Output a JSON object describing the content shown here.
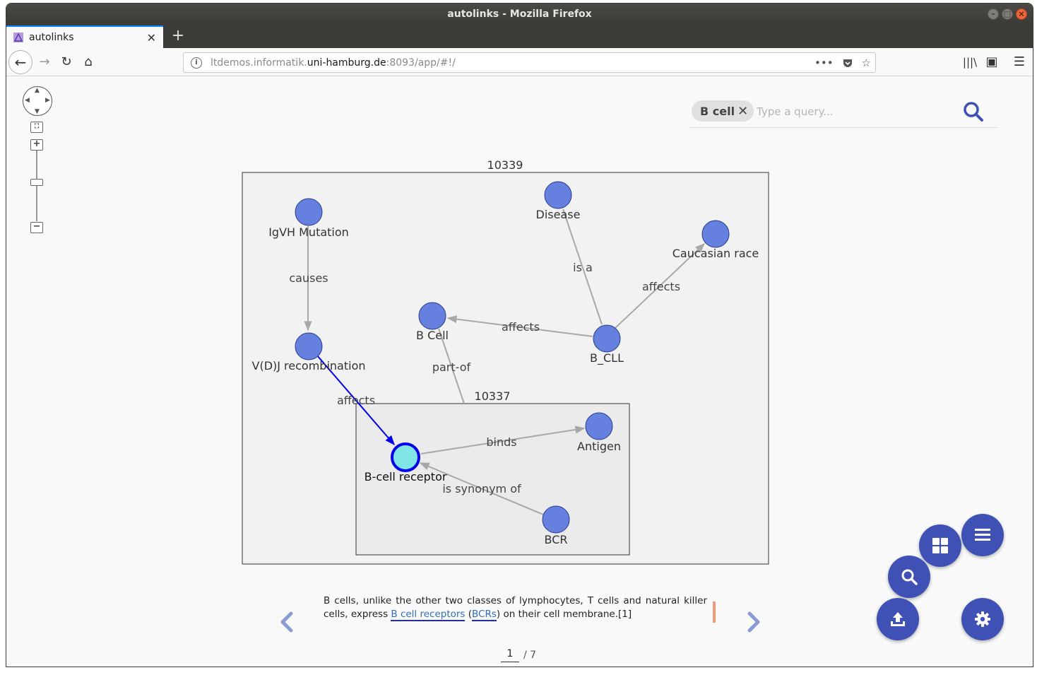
{
  "window": {
    "title": "autolinks - Mozilla Firefox"
  },
  "tab": {
    "title": "autolinks",
    "close": "✕",
    "new": "+"
  },
  "nav": {
    "url_prefix": "ltdemos.informatik.",
    "url_host": "uni-hamburg.de",
    "url_suffix": ":8093/app/#!/"
  },
  "search": {
    "chip_label": "B cell",
    "chip_remove": "✕",
    "placeholder": "Type a query..."
  },
  "graph": {
    "outer_group_label": "10339",
    "inner_group_label": "10337",
    "nodes": {
      "igvh": "IgVH Mutation",
      "vdj": "V(D)J recombination",
      "disease": "Disease",
      "caucasian": "Caucasian race",
      "bcell": "B Cell",
      "bcll": "B_CLL",
      "bcr_receptor": "B-cell receptor",
      "antigen": "Antigen",
      "bcr": "BCR"
    },
    "edges": {
      "causes": "causes",
      "is_a": "is a",
      "affects_caucasian": "affects",
      "affects_bcell": "affects",
      "part_of": "part-of",
      "affects_receptor": "affects",
      "binds": "binds",
      "synonym": "is synonym of"
    }
  },
  "sentence": {
    "part1": "B cells, unlike the other two classes of lymphocytes, T cells and natural killer cells, express ",
    "entity1": "B cell receptors",
    "part2": " (",
    "entity2": "BCRs",
    "part3": ") on their cell membrane.[1]"
  },
  "pager": {
    "current": "1",
    "total": "/ 7"
  },
  "colors": {
    "accent": "#3f51b5",
    "node": "#6680e0",
    "selected_node": "#7fe5e5",
    "selected_edge": "#0000ee"
  }
}
